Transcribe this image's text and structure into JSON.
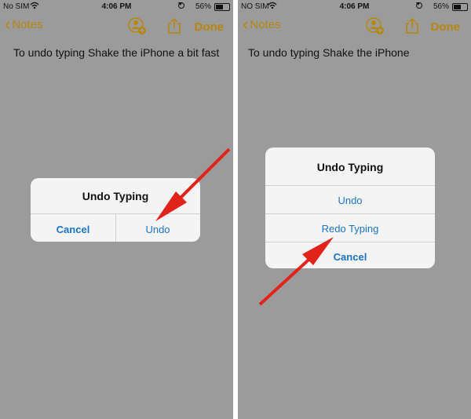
{
  "left": {
    "status": {
      "carrier": "No SIM",
      "time": "4:06 PM",
      "battery": "56%"
    },
    "nav": {
      "back_label": "Notes",
      "done_label": "Done"
    },
    "note_text": "To undo typing Shake the iPhone a bit fast",
    "dialog": {
      "title": "Undo Typing",
      "cancel": "Cancel",
      "undo": "Undo"
    }
  },
  "right": {
    "status": {
      "carrier": "NO SIM",
      "time": "4:06 PM",
      "battery": "56%"
    },
    "nav": {
      "back_label": "Notes",
      "done_label": "Done"
    },
    "note_text": "To undo typing Shake the iPhone",
    "dialog": {
      "title": "Undo Typing",
      "undo": "Undo",
      "redo": "Redo Typing",
      "cancel": "Cancel"
    }
  },
  "colors": {
    "accent": "#b8860b",
    "link": "#1a73c4",
    "arrow": "#e0231b",
    "dim": "#9b9b9b"
  },
  "icons": [
    "wifi-icon",
    "alarm-icon",
    "battery-icon",
    "chevron-left-icon",
    "add-person-icon",
    "share-icon",
    "arrow-annotation"
  ]
}
